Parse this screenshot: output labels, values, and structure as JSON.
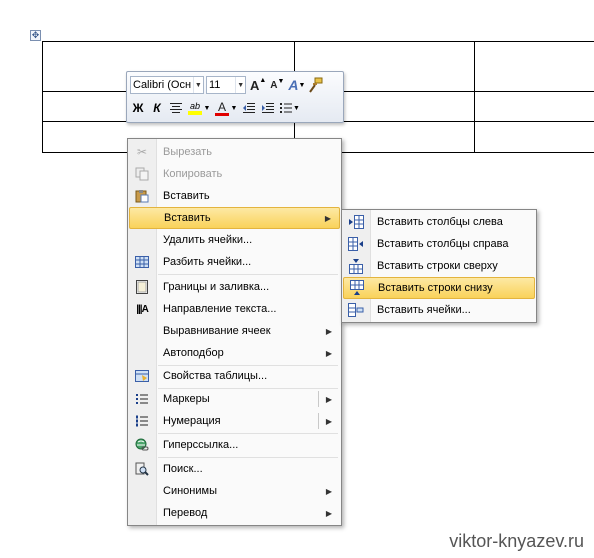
{
  "minibar": {
    "font_name": "Calibri (Осн",
    "font_size": "11",
    "grow_font_label": "A",
    "shrink_font_label": "A",
    "styles_label": "A",
    "bold_label": "Ж",
    "italic_label": "К",
    "highlight_label": "ab",
    "font_color_label": "A"
  },
  "context_menu": {
    "items": [
      {
        "label": "Вырезать",
        "icon": "scissors-icon",
        "disabled": true
      },
      {
        "label": "Копировать",
        "icon": "copy-icon",
        "disabled": true
      },
      {
        "label": "Вставить",
        "icon": "paste-icon",
        "disabled": false
      },
      {
        "label": "Вставить",
        "icon": "",
        "has_submenu": true,
        "active": true
      },
      {
        "label": "Удалить ячейки...",
        "icon": ""
      },
      {
        "label": "Разбить ячейки...",
        "icon": "split-cells-icon"
      },
      {
        "label": "Границы и заливка...",
        "icon": "borders-icon"
      },
      {
        "label": "Направление текста...",
        "icon": "text-direction-icon"
      },
      {
        "label": "Выравнивание ячеек",
        "icon": "",
        "has_submenu": true
      },
      {
        "label": "Автоподбор",
        "icon": "",
        "has_submenu": true
      },
      {
        "label": "Свойства таблицы...",
        "icon": "table-properties-icon"
      },
      {
        "label": "Маркеры",
        "icon": "bullets-icon",
        "has_submenu": true
      },
      {
        "label": "Нумерация",
        "icon": "numbering-icon",
        "has_submenu": true
      },
      {
        "label": "Гиперссылка...",
        "icon": "hyperlink-icon"
      },
      {
        "label": "Поиск...",
        "icon": "research-icon"
      },
      {
        "label": "Синонимы",
        "icon": "",
        "has_submenu": true
      },
      {
        "label": "Перевод",
        "icon": "",
        "has_submenu": true
      }
    ]
  },
  "submenu": {
    "items": [
      {
        "label": "Вставить столбцы слева",
        "icon": "insert-columns-left-icon"
      },
      {
        "label": "Вставить столбцы справа",
        "icon": "insert-columns-right-icon"
      },
      {
        "label": "Вставить строки сверху",
        "icon": "insert-rows-above-icon"
      },
      {
        "label": "Вставить строки снизу",
        "icon": "insert-rows-below-icon",
        "active": true
      },
      {
        "label": "Вставить ячейки...",
        "icon": "insert-cells-icon"
      }
    ]
  },
  "watermark": "viktor-knyazev.ru",
  "colors": {
    "highlight": "#fde9a4",
    "menu_border": "#868686",
    "font_color_red": "#e00000",
    "highlight_yellow": "#ffff00"
  }
}
